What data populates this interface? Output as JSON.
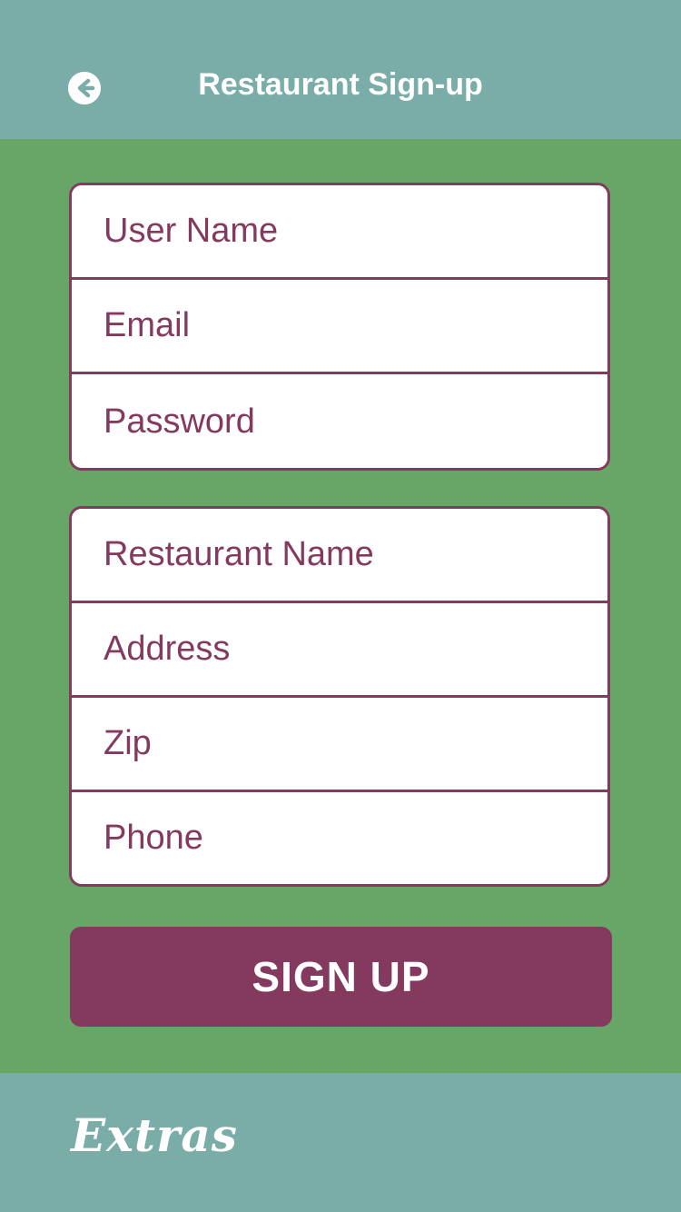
{
  "header": {
    "title": "Restaurant Sign-up",
    "back_icon": "arrow-left-circle-icon"
  },
  "account_fields": [
    {
      "placeholder": "User Name"
    },
    {
      "placeholder": "Email"
    },
    {
      "placeholder": "Password"
    }
  ],
  "restaurant_fields": [
    {
      "placeholder": "Restaurant Name"
    },
    {
      "placeholder": "Address"
    },
    {
      "placeholder": "Zip"
    },
    {
      "placeholder": "Phone"
    }
  ],
  "signup_button": {
    "label": "SIGN UP"
  },
  "footer": {
    "logo_text": "Extras"
  },
  "colors": {
    "header_bg": "#7aada7",
    "page_bg": "#67a667",
    "accent": "#843a5e",
    "card_bg": "#ffffff",
    "text_light": "#ffffff"
  }
}
